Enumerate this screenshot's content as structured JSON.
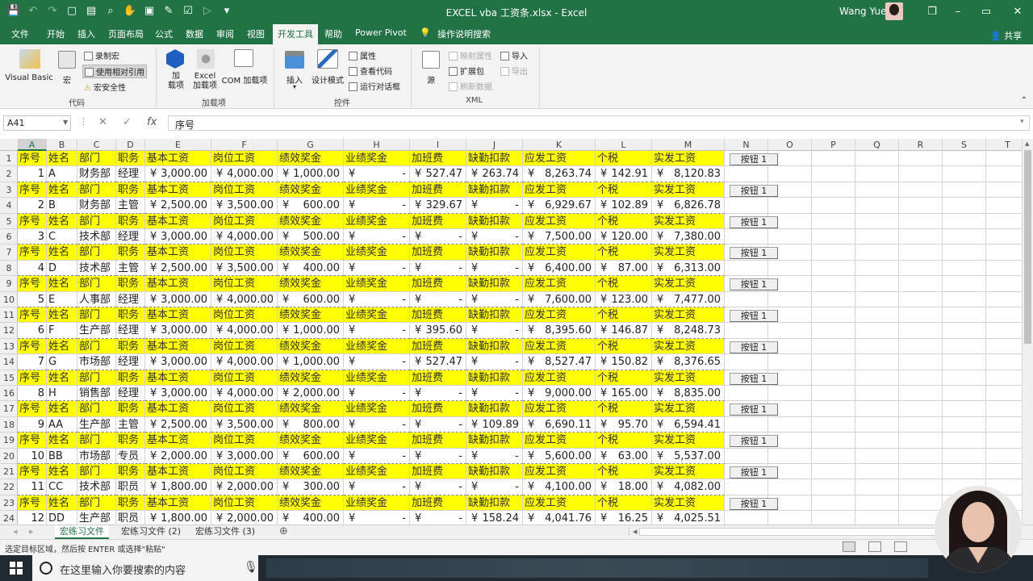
{
  "window": {
    "title": "EXCEL vba 工资条.xlsx  -  Excel",
    "user": "Wang Yue",
    "controls": [
      "–",
      "❐",
      "▭",
      "✕"
    ]
  },
  "quick_access": [
    "save-icon",
    "undo-icon",
    "redo-icon",
    "new-icon",
    "open-icon",
    "print-preview-icon",
    "touch-icon",
    "screenshot-icon",
    "format-icon",
    "check-icon",
    "play-icon",
    "customize-icon"
  ],
  "ribbon_tabs": [
    "文件",
    "开始",
    "插入",
    "页面布局",
    "公式",
    "数据",
    "审阅",
    "视图",
    "开发工具",
    "帮助",
    "Power Pivot",
    "操作说明搜索"
  ],
  "active_tab": "开发工具",
  "share_label": "共享",
  "ribbon": {
    "code": {
      "label": "代码",
      "visual_basic": "Visual Basic",
      "macros": "宏",
      "record_macro": "录制宏",
      "relative_ref": "使用相对引用",
      "macro_security": "宏安全性"
    },
    "addins": {
      "label": "加载项",
      "addins": "加\n载项",
      "excel_addins": "Excel\n加载项",
      "com_addins": "COM 加载项"
    },
    "controls": {
      "label": "控件",
      "insert": "插入",
      "design_mode": "设计模式",
      "properties": "属性",
      "view_code": "查看代码",
      "run_dialog": "运行对话框"
    },
    "xml": {
      "label": "XML",
      "source": "源",
      "map_properties": "映射属性",
      "expansion_packs": "扩展包",
      "refresh_data": "刷新数据",
      "import": "导入",
      "export": "导出"
    }
  },
  "formula_bar": {
    "name_box": "A41",
    "formula": "序号",
    "cancel": "✕",
    "enter": "✓",
    "fx": "fx"
  },
  "columns": [
    "A",
    "B",
    "C",
    "D",
    "E",
    "F",
    "G",
    "H",
    "I",
    "J",
    "K",
    "L",
    "M",
    "N",
    "O",
    "P",
    "Q",
    "R",
    "S",
    "T"
  ],
  "header_labels": [
    "序号",
    "姓名",
    "部门",
    "职务",
    "基本工资",
    "岗位工资",
    "绩效奖金",
    "业绩奖金",
    "加班费",
    "缺勤扣款",
    "应发工资",
    "个税",
    "实发工资"
  ],
  "button_label": "按钮 1",
  "currency": "¥",
  "dash": "-",
  "records": [
    {
      "no": "1",
      "name": "A",
      "dept": "财务部",
      "title": "经理",
      "base": "3,000.00",
      "post": "4,000.00",
      "perf": "1,000.00",
      "bonus": "-",
      "ot": "527.47",
      "absence": "263.74",
      "gross": "8,263.74",
      "tax": "142.91",
      "net": "8,120.83"
    },
    {
      "no": "2",
      "name": "B",
      "dept": "财务部",
      "title": "主管",
      "base": "2,500.00",
      "post": "3,500.00",
      "perf": "600.00",
      "bonus": "-",
      "ot": "329.67",
      "absence": "-",
      "gross": "6,929.67",
      "tax": "102.89",
      "net": "6,826.78"
    },
    {
      "no": "3",
      "name": "C",
      "dept": "技术部",
      "title": "经理",
      "base": "3,000.00",
      "post": "4,000.00",
      "perf": "500.00",
      "bonus": "-",
      "ot": "-",
      "absence": "-",
      "gross": "7,500.00",
      "tax": "120.00",
      "net": "7,380.00"
    },
    {
      "no": "4",
      "name": "D",
      "dept": "技术部",
      "title": "主管",
      "base": "2,500.00",
      "post": "3,500.00",
      "perf": "400.00",
      "bonus": "-",
      "ot": "-",
      "absence": "-",
      "gross": "6,400.00",
      "tax": "87.00",
      "net": "6,313.00"
    },
    {
      "no": "5",
      "name": "E",
      "dept": "人事部",
      "title": "经理",
      "base": "3,000.00",
      "post": "4,000.00",
      "perf": "600.00",
      "bonus": "-",
      "ot": "-",
      "absence": "-",
      "gross": "7,600.00",
      "tax": "123.00",
      "net": "7,477.00"
    },
    {
      "no": "6",
      "name": "F",
      "dept": "生产部",
      "title": "经理",
      "base": "3,000.00",
      "post": "4,000.00",
      "perf": "1,000.00",
      "bonus": "-",
      "ot": "395.60",
      "absence": "-",
      "gross": "8,395.60",
      "tax": "146.87",
      "net": "8,248.73"
    },
    {
      "no": "7",
      "name": "G",
      "dept": "市场部",
      "title": "经理",
      "base": "3,000.00",
      "post": "4,000.00",
      "perf": "1,000.00",
      "bonus": "-",
      "ot": "527.47",
      "absence": "-",
      "gross": "8,527.47",
      "tax": "150.82",
      "net": "8,376.65"
    },
    {
      "no": "8",
      "name": "H",
      "dept": "销售部",
      "title": "经理",
      "base": "3,000.00",
      "post": "4,000.00",
      "perf": "2,000.00",
      "bonus": "-",
      "ot": "-",
      "absence": "-",
      "gross": "9,000.00",
      "tax": "165.00",
      "net": "8,835.00"
    },
    {
      "no": "9",
      "name": "AA",
      "dept": "生产部",
      "title": "主管",
      "base": "2,500.00",
      "post": "3,500.00",
      "perf": "800.00",
      "bonus": "-",
      "ot": "-",
      "absence": "109.89",
      "gross": "6,690.11",
      "tax": "95.70",
      "net": "6,594.41"
    },
    {
      "no": "10",
      "name": "BB",
      "dept": "市场部",
      "title": "专员",
      "base": "2,000.00",
      "post": "3,000.00",
      "perf": "600.00",
      "bonus": "-",
      "ot": "-",
      "absence": "-",
      "gross": "5,600.00",
      "tax": "63.00",
      "net": "5,537.00"
    },
    {
      "no": "11",
      "name": "CC",
      "dept": "技术部",
      "title": "职员",
      "base": "1,800.00",
      "post": "2,000.00",
      "perf": "300.00",
      "bonus": "-",
      "ot": "-",
      "absence": "-",
      "gross": "4,100.00",
      "tax": "18.00",
      "net": "4,082.00"
    },
    {
      "no": "12",
      "name": "DD",
      "dept": "生产部",
      "title": "职员",
      "base": "1,800.00",
      "post": "2,000.00",
      "perf": "400.00",
      "bonus": "-",
      "ot": "-",
      "absence": "158.24",
      "gross": "4,041.76",
      "tax": "16.25",
      "net": "4,025.51"
    }
  ],
  "sheet_tabs": [
    "宏练习文件",
    "宏练习文件 (2)",
    "宏练习文件 (3)"
  ],
  "active_sheet": "宏练习文件",
  "status_message": "选定目标区域，然后按 ENTER 或选择\"粘贴\"",
  "taskbar": {
    "search_placeholder": "在这里输入你要搜索的内容"
  }
}
